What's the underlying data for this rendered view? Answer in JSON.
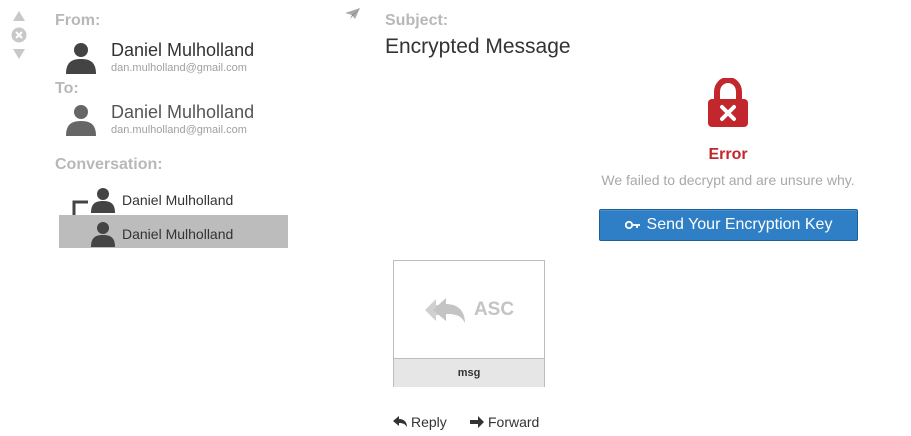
{
  "header": {
    "from_label": "From:",
    "to_label": "To:",
    "conversation_label": "Conversation:",
    "subject_label": "Subject:"
  },
  "from": {
    "name": "Daniel Mulholland",
    "email": "dan.mulholland@gmail.com"
  },
  "to": {
    "name": "Daniel Mulholland",
    "email": "dan.mulholland@gmail.com"
  },
  "conversation": {
    "items": [
      {
        "name": "Daniel Mulholland",
        "selected": false
      },
      {
        "name": "Daniel Mulholland",
        "selected": true
      }
    ]
  },
  "message": {
    "subject": "Encrypted Message",
    "error_title": "Error",
    "error_text": "We failed to decrypt and are unsure why.",
    "send_key_label": "Send Your Encryption Key"
  },
  "attachment": {
    "type_label": "ASC",
    "filename": "msg"
  },
  "actions": {
    "reply_label": "Reply",
    "forward_label": "Forward"
  },
  "icons": {
    "nav_up": "triangle-up-icon",
    "nav_close": "close-circle-icon",
    "nav_down": "triangle-down-icon",
    "sent": "paper-plane-icon",
    "lock_error": "lock-error-icon",
    "key": "key-icon",
    "reply_all": "reply-all-icon",
    "reply": "reply-icon",
    "forward": "forward-arrow-icon"
  },
  "colors": {
    "error_red": "#c1272d",
    "button_blue": "#2e7fc6",
    "label_gray": "#b8b8b8",
    "selected_bg": "#bcbcbc"
  }
}
